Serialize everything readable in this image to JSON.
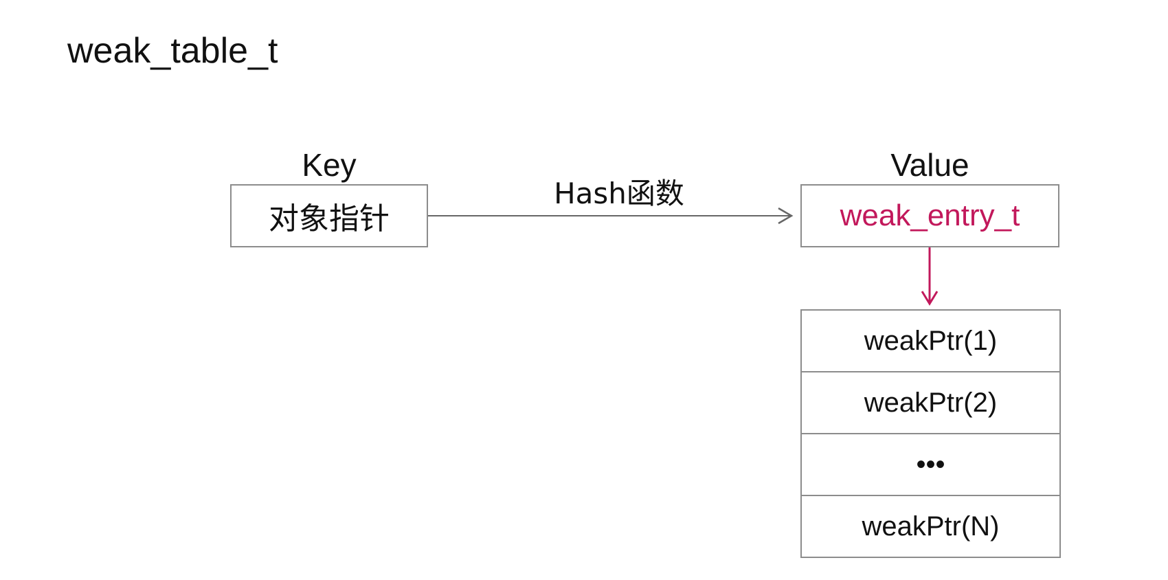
{
  "title": "weak_table_t",
  "key": {
    "heading": "Key",
    "label": "对象指针"
  },
  "value": {
    "heading": "Value",
    "label": "weak_entry_t"
  },
  "edge_label": "Hash函数",
  "weak_ptrs": [
    "weakPtr(1)",
    "weakPtr(2)",
    "•••",
    "weakPtr(N)"
  ],
  "colors": {
    "accent": "#c2185b",
    "border": "#8c8c8c",
    "arrow": "#666666",
    "text": "#111111"
  }
}
